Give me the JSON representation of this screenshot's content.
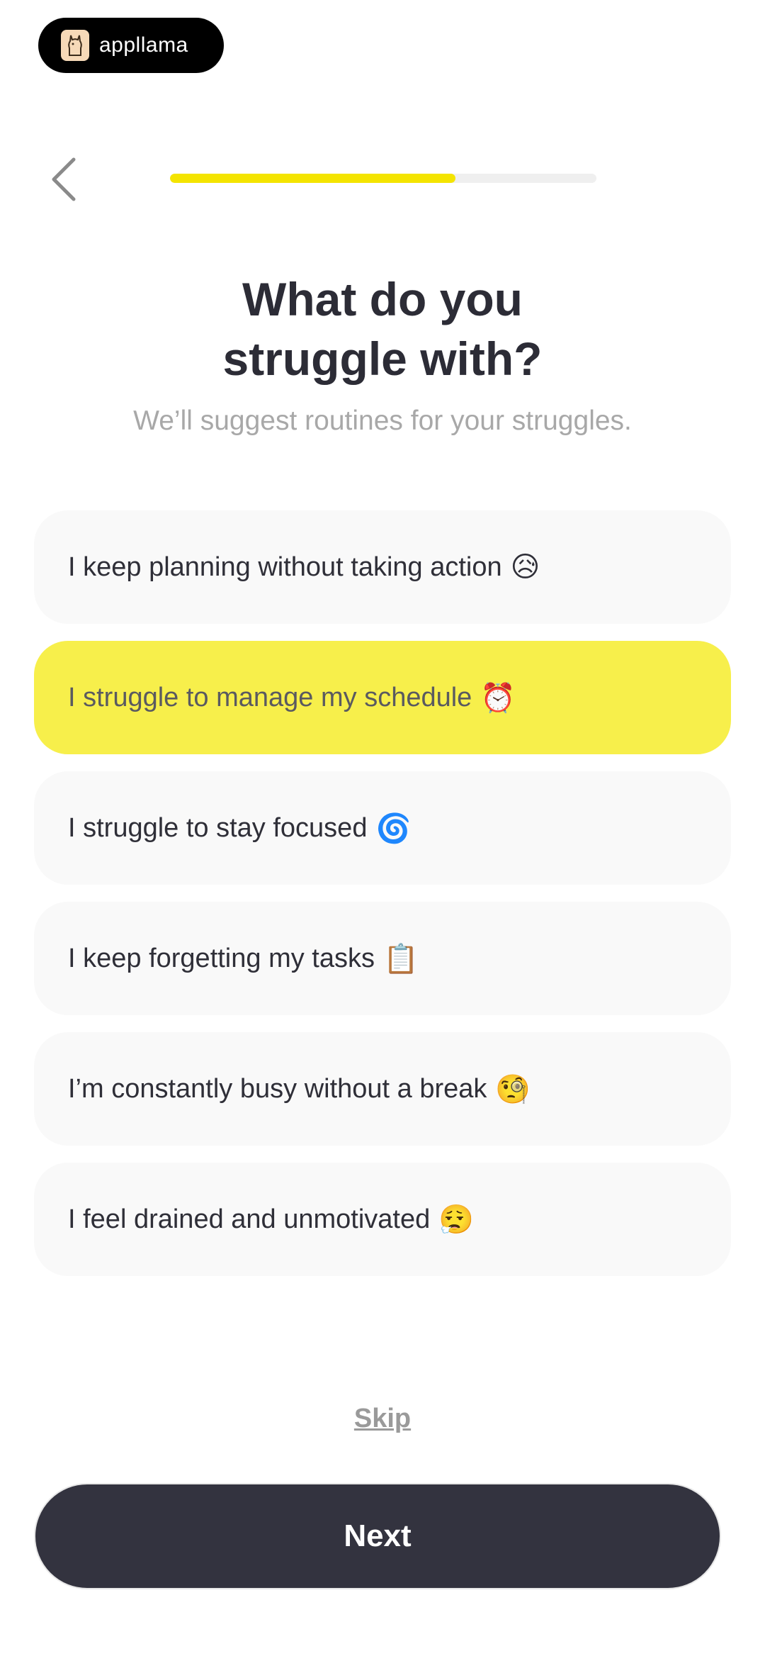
{
  "brand": {
    "name": "appllama",
    "logo_icon": "llama-logo-icon"
  },
  "header": {
    "back_icon": "chevron-left-icon",
    "progress_percent": 67
  },
  "title": {
    "line1": "What do you",
    "line2": "struggle with?"
  },
  "subtitle": "We’ll suggest routines for your struggles.",
  "options": [
    {
      "label": "I keep planning without taking action",
      "emoji": "😥",
      "selected": false
    },
    {
      "label": "I struggle to manage my schedule",
      "emoji": "⏰",
      "selected": true
    },
    {
      "label": "I struggle to stay focused",
      "emoji": "🌀",
      "selected": false
    },
    {
      "label": "I keep forgetting my tasks",
      "emoji": "📋",
      "selected": false
    },
    {
      "label": "I’m constantly busy without a break",
      "emoji": "🧐",
      "selected": false
    },
    {
      "label": "I feel drained and unmotivated",
      "emoji": "😮‍💨",
      "selected": false
    }
  ],
  "actions": {
    "skip_label": "Skip",
    "next_label": "Next"
  },
  "colors": {
    "accent_yellow": "#f4e400",
    "selected_option": "#f7ef4b",
    "button_dark": "#33333f"
  }
}
